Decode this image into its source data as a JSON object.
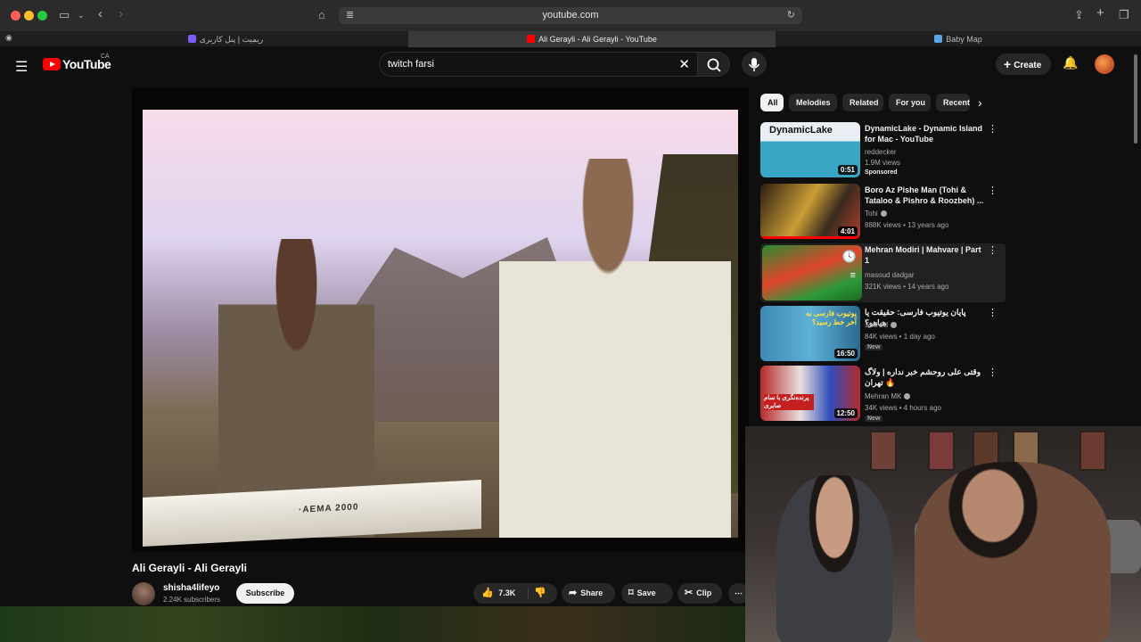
{
  "browser": {
    "url": "youtube.com",
    "tabs": [
      {
        "label": "ریمیت | پنل کاربری",
        "active": false
      },
      {
        "label": "Ali Gerayli - Ali Gerayli - YouTube",
        "active": true
      },
      {
        "label": "Baby Map",
        "active": false
      }
    ]
  },
  "header": {
    "logo_text": "YouTube",
    "logo_country": "CA",
    "search_value": "twitch farsi",
    "create_label": "Create"
  },
  "video": {
    "title": "Ali Gerayli - Ali Gerayli",
    "keyboard_label": "·AEMA 2000",
    "channel_name": "shisha4lifeyo",
    "subscribers": "2.24K subscribers",
    "subscribe_label": "Subscribe",
    "likes": "7.3K",
    "share_label": "Share",
    "save_label": "Save",
    "clip_label": "Clip"
  },
  "chips": [
    "All",
    "Melodies",
    "Related",
    "For you",
    "Recently uploaded"
  ],
  "recommendations": [
    {
      "title": "DynamicLake - Dynamic Island for Mac - YouTube",
      "channel": "reddecker",
      "meta": "1.9M views",
      "badge": "Sponsored",
      "duration": "0:51",
      "thumb_text": "DynamicLake"
    },
    {
      "title": "Boro Az Pishe Man (Tohi & Tataloo & Pishro & Roozbeh) ...",
      "channel": "Tohi",
      "meta": "888K views • 13 years ago",
      "badge": "",
      "duration": "4:01"
    },
    {
      "title": "Mehran Modiri | Mahvare | Part 1",
      "channel": "masoud dadgar",
      "meta": "321K views • 14 years ago",
      "badge": "",
      "duration": ""
    },
    {
      "title": "پایان یوتیوب فارسی: حقیقت یا هیاهو؟",
      "channel": "SkillVid",
      "meta": "84K views • 1 day ago",
      "badge": "New",
      "duration": "16:50",
      "thumb_text": "یوتیوب فارسی به آخر خط رسید؟"
    },
    {
      "title": "وقتی علی روحشم خبر نداره | ولاگ تهران 🔥",
      "channel": "Mehran MK",
      "meta": "34K views • 4 hours ago",
      "badge": "New",
      "duration": "12:50",
      "thumb_text": "پرنده‌نگری با سام صابری"
    }
  ]
}
